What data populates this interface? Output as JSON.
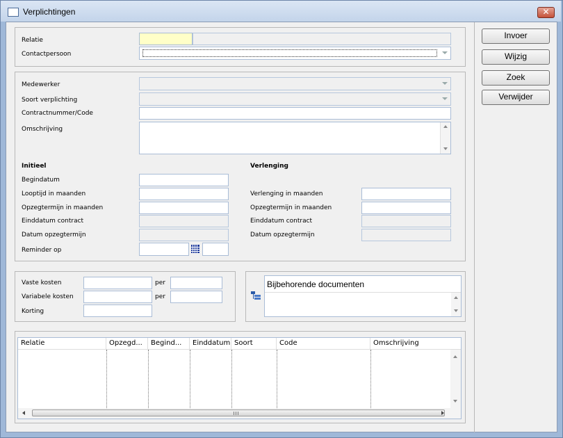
{
  "window": {
    "title": "Verplichtingen",
    "close_glyph": "✕"
  },
  "relatie_section": {
    "relatie_label": "Relatie",
    "contactpersoon_label": "Contactpersoon"
  },
  "details": {
    "medewerker_label": "Medewerker",
    "soort_label": "Soort verplichting",
    "contract_label": "Contractnummer/Code",
    "omschrijving_label": "Omschrijving"
  },
  "initieel": {
    "heading": "Initieel",
    "begindatum_label": "Begindatum",
    "looptijd_label": "Looptijd in maanden",
    "opzeg_label": "Opzegtermijn in maanden",
    "einddatum_label": "Einddatum contract",
    "datum_opzeg_label": "Datum opzegtermijn",
    "reminder_label": "Reminder op"
  },
  "verlenging": {
    "heading": "Verlenging",
    "verlenging_label": "Verlenging in maanden",
    "opzeg_label": "Opzegtermijn in maanden",
    "einddatum_label": "Einddatum contract",
    "datum_opzeg_label": "Datum opzegtermijn"
  },
  "kosten": {
    "vaste_label": "Vaste kosten",
    "variabele_label": "Variabele kosten",
    "korting_label": "Korting",
    "per_label": "per"
  },
  "documents": {
    "heading": "Bijbehorende documenten"
  },
  "grid": {
    "columns": [
      "Relatie",
      "Opzegd...",
      "Begind...",
      "Einddatum",
      "Soort",
      "Code",
      "Omschrijving"
    ]
  },
  "buttons": {
    "invoer": "Invoer",
    "wijzig": "Wijzig",
    "zoek": "Zoek",
    "verwijder": "Verwijder"
  },
  "colors": {
    "relatie_highlight": "#ffffc8",
    "field_border": "#a9bcd6",
    "window_frame": "#9fb8d8"
  }
}
